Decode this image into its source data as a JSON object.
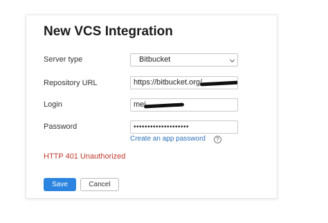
{
  "dialog": {
    "title": "New VCS Integration",
    "server_type": {
      "label": "Server type",
      "value": "Bitbucket"
    },
    "repository_url": {
      "label": "Repository URL",
      "value": "https://bitbucket.org/"
    },
    "login": {
      "label": "Login",
      "value": "mei"
    },
    "password": {
      "label": "Password",
      "value": "••••••••••••••••••••"
    },
    "create_password_link": "Create an app password",
    "help_glyph": "?",
    "error": "HTTP 401 Unauthorized",
    "save_label": "Save",
    "cancel_label": "Cancel",
    "colors": {
      "primary": "#2a84e0",
      "link": "#2a6fb8",
      "error": "#c0392b"
    }
  }
}
